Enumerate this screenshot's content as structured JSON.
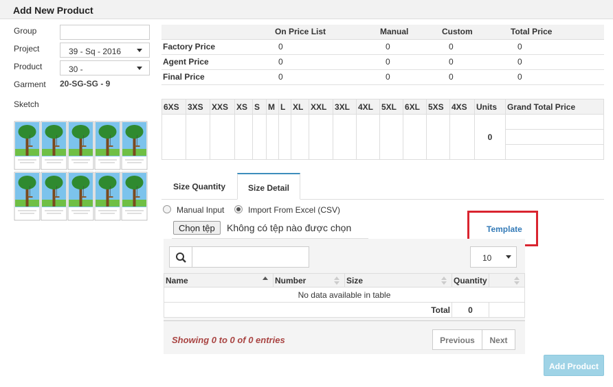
{
  "header": {
    "title": "Add New Product"
  },
  "form": {
    "group_label": "Group",
    "group_value": "",
    "project_label": "Project",
    "project_value": "39 - Sq - 2016",
    "product_label": "Product",
    "product_value": "30 -",
    "garment_label": "Garment",
    "garment_value": "20-SG-SG - 9",
    "sketch_label": "Sketch"
  },
  "price_table": {
    "headers": [
      "",
      "On Price List",
      "Manual",
      "Custom",
      "Total Price"
    ],
    "rows": [
      {
        "label": "Factory Price",
        "values": [
          "0",
          "0",
          "0",
          "0"
        ]
      },
      {
        "label": "Agent Price",
        "values": [
          "0",
          "0",
          "0",
          "0"
        ]
      },
      {
        "label": "Final Price",
        "values": [
          "0",
          "0",
          "0",
          "0"
        ]
      }
    ]
  },
  "size_table": {
    "headers": [
      "6XS",
      "3XS",
      "XXS",
      "XS",
      "S",
      "M",
      "L",
      "XL",
      "XXL",
      "3XL",
      "4XL",
      "5XL",
      "6XL",
      "5XS",
      "4XS",
      "Units",
      "Grand Total Price"
    ],
    "units_value": "0"
  },
  "tabs": [
    {
      "label": "Size Quantity",
      "active": false
    },
    {
      "label": "Size Detail",
      "active": true
    }
  ],
  "import": {
    "manual_label": "Manual Input",
    "excel_label": "Import From Excel (CSV)",
    "choose_file_label": "Chọn tệp",
    "no_file_text": "Không có tệp nào được chọn",
    "template_link": "Template",
    "highlight_color": "#d9242f"
  },
  "datatable": {
    "search_value": "",
    "page_length": "10",
    "columns": [
      "Name",
      "Number",
      "Size",
      "Quantity",
      ""
    ],
    "empty_text": "No data available in table",
    "total_label": "Total",
    "total_value": "0",
    "info_text": "Showing 0 to 0 of 0 entries",
    "prev_label": "Previous",
    "next_label": "Next"
  },
  "footer": {
    "add_button": "Add Product"
  },
  "colors": {
    "accent": "#3c8dbc",
    "info_text": "#a94442",
    "add_button_bg": "#9fd3e6"
  }
}
